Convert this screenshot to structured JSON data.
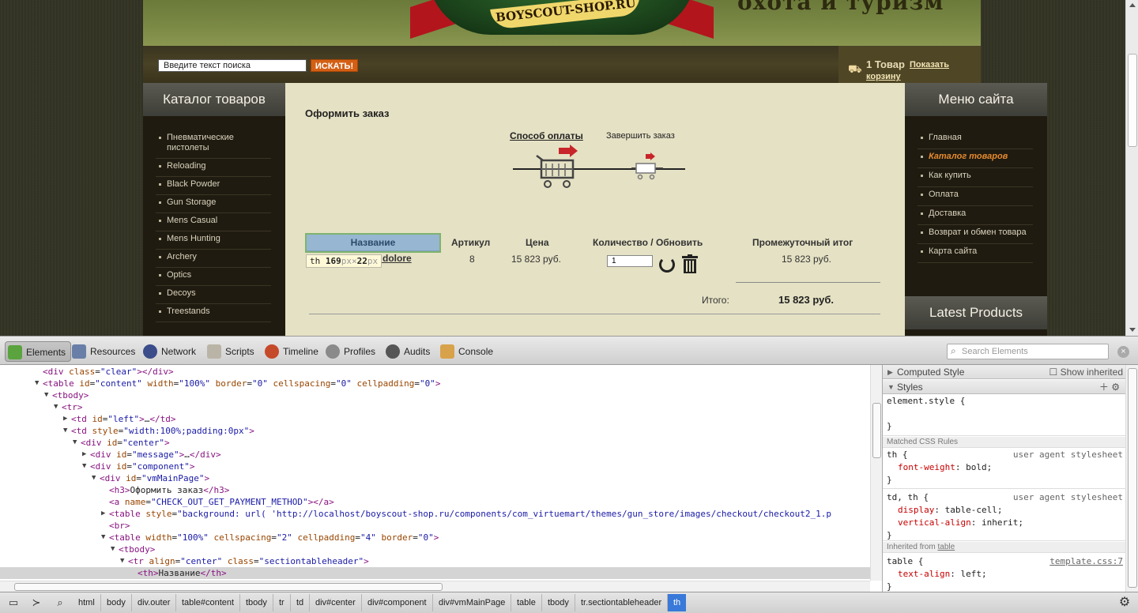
{
  "site": {
    "logo_text": "BOYSCOUT-SHOP.RU",
    "slogan": "охота и туризм",
    "search": {
      "placeholder": "Введите текст поиска",
      "button": "ИСКАТЬ!"
    },
    "cart": {
      "count": "1 Товар",
      "link_part1": "Показать",
      "link_part2": "корзину"
    },
    "catalog": {
      "title": "Каталог товаров",
      "items": [
        "Пневматические пистолеты",
        "Reloading",
        "Black Powder",
        "Gun Storage",
        "Mens Casual",
        "Mens Hunting",
        "Archery",
        "Optics",
        "Decoys",
        "Treestands"
      ]
    },
    "menu": {
      "title": "Меню сайта",
      "items": [
        "Главная",
        "Каталог товаров",
        "Как купить",
        "Оплата",
        "Доставка",
        "Возврат и обмен товара",
        "Карта сайта"
      ],
      "latest_title": "Latest Products"
    },
    "checkout": {
      "title": "Оформить заказ",
      "step1": "Способ оплаты",
      "step2": "Завершить заказ",
      "headers": {
        "name": "Название",
        "sku": "Артикул",
        "price": "Цена",
        "qty": "Количество / Обновить",
        "subtotal": "Промежуточный итог"
      },
      "row": {
        "name_visible": "a dolore",
        "sku": "8",
        "price": "15 823 руб.",
        "qty": "1",
        "subtotal": "15 823 руб."
      },
      "total_label": "Итого:",
      "total_value": "15 823 руб.",
      "tooltip": {
        "tag": "th",
        "w": "169",
        "unit1": "px",
        "times": "×",
        "h": "22",
        "unit2": "px"
      }
    }
  },
  "devtools": {
    "tabs": [
      "Elements",
      "Resources",
      "Network",
      "Scripts",
      "Timeline",
      "Profiles",
      "Audits",
      "Console"
    ],
    "search_placeholder": "Search Elements",
    "dom": [
      {
        "indent": 54,
        "tw": "",
        "html": "<span class='tag'>&lt;div</span> <span class='attr'>class</span>=<span class='val'>\"clear\"</span><span class='tag'>&gt;&lt;/div&gt;</span>"
      },
      {
        "indent": 54,
        "tw": "▼",
        "html": "<span class='tag'>&lt;table</span> <span class='attr'>id</span>=<span class='val'>\"content\"</span> <span class='attr'>width</span>=<span class='val'>\"100%\"</span> <span class='attr'>border</span>=<span class='val'>\"0\"</span> <span class='attr'>cellspacing</span>=<span class='val'>\"0\"</span> <span class='attr'>cellpadding</span>=<span class='val'>\"0\"</span><span class='tag'>&gt;</span>"
      },
      {
        "indent": 66,
        "tw": "▼",
        "html": "<span class='tag'>&lt;tbody&gt;</span>"
      },
      {
        "indent": 78,
        "tw": "▼",
        "html": "<span class='tag'>&lt;tr&gt;</span>"
      },
      {
        "indent": 90,
        "tw": "▶",
        "html": "<span class='tag'>&lt;td</span> <span class='attr'>id</span>=<span class='val'>\"left\"</span><span class='tag'>&gt;</span>…<span class='tag'>&lt;/td&gt;</span>"
      },
      {
        "indent": 90,
        "tw": "▼",
        "html": "<span class='tag'>&lt;td</span> <span class='attr'>style</span>=<span class='val'>\"width:100%;padding:0px\"</span><span class='tag'>&gt;</span>"
      },
      {
        "indent": 102,
        "tw": "▼",
        "html": "<span class='tag'>&lt;div</span> <span class='attr'>id</span>=<span class='val'>\"center\"</span><span class='tag'>&gt;</span>"
      },
      {
        "indent": 114,
        "tw": "▶",
        "html": "<span class='tag'>&lt;div</span> <span class='attr'>id</span>=<span class='val'>\"message\"</span><span class='tag'>&gt;</span>…<span class='tag'>&lt;/div&gt;</span>"
      },
      {
        "indent": 114,
        "tw": "▼",
        "html": "<span class='tag'>&lt;div</span> <span class='attr'>id</span>=<span class='val'>\"component\"</span><span class='tag'>&gt;</span>"
      },
      {
        "indent": 126,
        "tw": "▼",
        "html": "<span class='tag'>&lt;div</span> <span class='attr'>id</span>=<span class='val'>\"vmMainPage\"</span><span class='tag'>&gt;</span>"
      },
      {
        "indent": 138,
        "tw": "",
        "html": "<span class='tag'>&lt;h3&gt;</span><span class='txt'>Оформить заказ</span><span class='tag'>&lt;/h3&gt;</span>"
      },
      {
        "indent": 138,
        "tw": "",
        "html": "<span class='tag'>&lt;a</span> <span class='attr'>name</span>=<span class='val'>\"CHECK_OUT_GET_PAYMENT_METHOD\"</span><span class='tag'>&gt;&lt;/a&gt;</span>"
      },
      {
        "indent": 138,
        "tw": "▶",
        "html": "<span class='tag'>&lt;table</span> <span class='attr'>style</span>=<span class='val'>\"background: url( 'http://localhost/boyscout-shop.ru/components/com_virtuemart/themes/gun_store/images/checkout/checkout2_1.p</span>"
      },
      {
        "indent": 138,
        "tw": "",
        "html": "<span class='tag'>&lt;br&gt;</span>"
      },
      {
        "indent": 138,
        "tw": "▼",
        "html": "<span class='tag'>&lt;table</span> <span class='attr'>width</span>=<span class='val'>\"100%\"</span> <span class='attr'>cellspacing</span>=<span class='val'>\"2\"</span> <span class='attr'>cellpadding</span>=<span class='val'>\"4\"</span> <span class='attr'>border</span>=<span class='val'>\"0\"</span><span class='tag'>&gt;</span>"
      },
      {
        "indent": 150,
        "tw": "▼",
        "html": "<span class='tag'>&lt;tbody&gt;</span>"
      },
      {
        "indent": 162,
        "tw": "▼",
        "html": "<span class='tag'>&lt;tr</span> <span class='attr'>align</span>=<span class='val'>\"center\"</span> <span class='attr'>class</span>=<span class='val'>\"sectiontableheader\"</span><span class='tag'>&gt;</span>"
      },
      {
        "indent": 174,
        "tw": "",
        "html": "<span class='tag'>&lt;th&gt;</span><span class='txt'>Название</span><span class='tag'>&lt;/th&gt;</span>",
        "selected": true
      }
    ],
    "styles": {
      "computed": "Computed Style",
      "show_inherited": "Show inherited",
      "styles_title": "Styles",
      "element_style": "element.style {",
      "close_brace": "}",
      "matched": "Matched CSS Rules",
      "inherited": "Inherited from",
      "inherited_el": "table",
      "rules": {
        "th_sel": "th {",
        "th_src": "user agent stylesheet",
        "th_prop": "font-weight",
        "th_val": "bold;",
        "td_sel": "td, th {",
        "td_src": "user agent stylesheet",
        "td_prop1": "display",
        "td_val1": "table-cell;",
        "td_prop2": "vertical-align",
        "td_val2": "inherit;",
        "tb_sel": "table {",
        "tb_src": "template.css:7",
        "tb_prop": "text-align",
        "tb_val": "left;"
      }
    },
    "breadcrumbs": [
      "html",
      "body",
      "div.outer",
      "table#content",
      "tbody",
      "tr",
      "td",
      "div#center",
      "div#component",
      "div#vmMainPage",
      "table",
      "tbody",
      "tr.sectiontableheader",
      "th"
    ]
  }
}
